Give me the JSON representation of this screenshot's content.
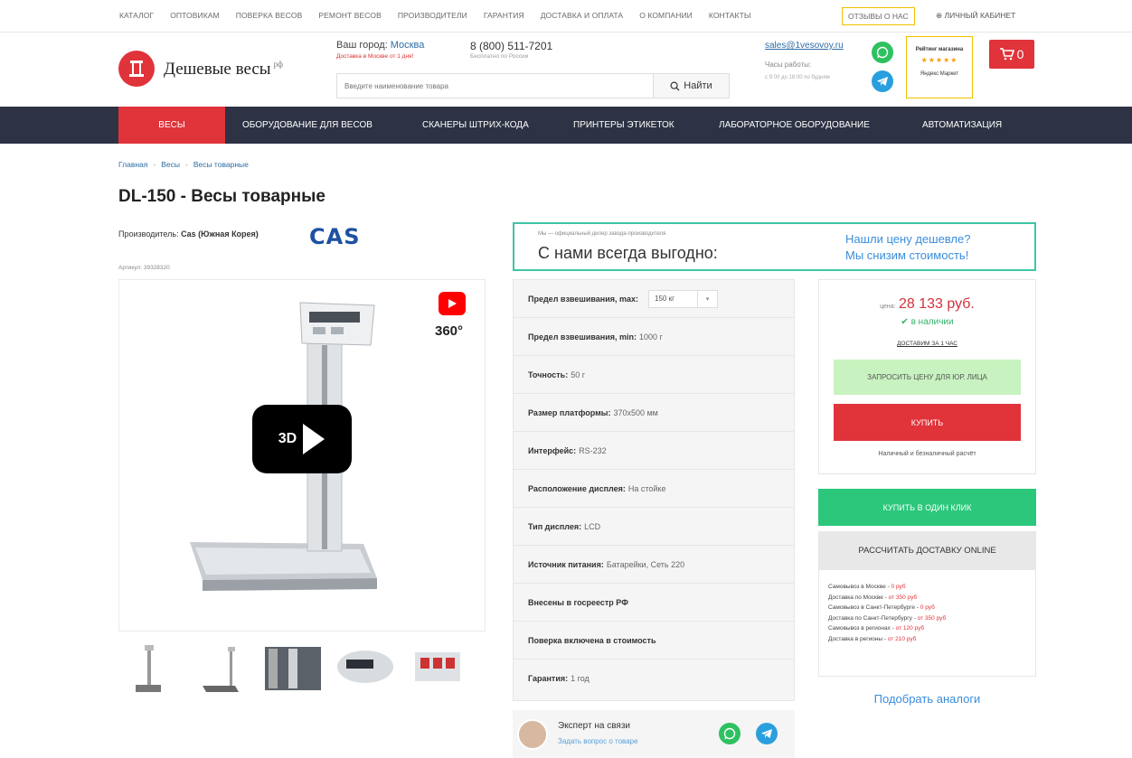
{
  "topbar": {
    "links": [
      "Каталог",
      "Оптовикам",
      "Поверка весов",
      "Ремонт весов",
      "Производители",
      "Гарантия",
      "Доставка и оплата",
      "О компании",
      "Контакты"
    ],
    "reviews": "Отзывы о нас",
    "cabinet": "Личный кабинет"
  },
  "header": {
    "logo_text": "Дешевые весы",
    "logo_suffix": "рф",
    "city_label": "Ваш город:",
    "city": "Москва",
    "city_sub": "Доставка в Москве от 1 дня!",
    "phone": "8 (800) 511-7201",
    "phone_sub": "Бесплатно по России",
    "search_placeholder": "Введите наименование товара",
    "search_button": "Найти",
    "email": "sales@1vesovoy.ru",
    "hours_label": "Часы работы:",
    "hours": "с 9:00 до 18:00 по будням",
    "rating_title": "Рейтинг магазина",
    "rating_stars": "★★★★★",
    "rating_source": "Яндекс Маркет",
    "cart_count": "0"
  },
  "nav": [
    "Весы",
    "Оборудование для весов",
    "Сканеры штрих-кода",
    "Принтеры этикеток",
    "Лабораторное оборудование",
    "Автоматизация"
  ],
  "breadcrumb": [
    "Главная",
    "Весы",
    "Весы товарные"
  ],
  "product": {
    "title": "DL-150 - Весы товарные",
    "maker_label": "Производитель:",
    "maker": "Cas (Южная Корея)",
    "brand_logo": "CAS",
    "sku": "Артикул: 39328320",
    "badge_3d": "3D",
    "badge_360": "360°"
  },
  "promo": {
    "small": "Мы — официальный дилер завода-производителя",
    "big": "С нами всегда выгодно:",
    "link1": "Нашли цену дешевле?",
    "link2": "Мы снизим стоимость!"
  },
  "specs": {
    "limit_max_label": "Предел взвешивания, max:",
    "limit_max_value": "150 кг",
    "rows": [
      {
        "label": "Предел взвешивания, min:",
        "value": "1000 г"
      },
      {
        "label": "Точность:",
        "value": "50 г"
      },
      {
        "label": "Размер платформы:",
        "value": "370x500 мм"
      },
      {
        "label": "Интерфейс:",
        "value": "RS-232"
      },
      {
        "label": "Расположение дисплея:",
        "value": "На стойке"
      },
      {
        "label": "Тип дисплея:",
        "value": "LCD"
      },
      {
        "label": "Источник питания:",
        "value": "Батарейки, Сеть 220"
      },
      {
        "label": "Внесены в госреестр РФ",
        "value": ""
      },
      {
        "label": "Поверка включена в стоимость",
        "value": ""
      },
      {
        "label": "Гарантия:",
        "value": "1 год"
      }
    ]
  },
  "expert": {
    "title": "Эксперт на связи",
    "link": "Задать вопрос о товаре"
  },
  "price": {
    "label": "цена:",
    "value": "28 133 руб.",
    "stock": "в наличии",
    "delivery_1h": "доставим за 1 час",
    "legal_button": "Запросить цену для юр. лица",
    "buy_button": "Купить",
    "pay_note": "Наличный и безналичный расчёт"
  },
  "oneclick_button": "Купить в один клик",
  "calc_button": "Рассчитать доставку ONLINE",
  "delivery_rows": [
    {
      "text": "Самовывоз в Москве - ",
      "price": "0 руб"
    },
    {
      "text": "Доставка по Москве - ",
      "price": "от 350 руб"
    },
    {
      "text": "Самовывоз в Санкт-Петербурге - ",
      "price": "0 руб"
    },
    {
      "text": "Доставка по Санкт-Петербургу - ",
      "price": "от 350 руб"
    },
    {
      "text": "Самовывоз в регионах - ",
      "price": "от 120 руб"
    },
    {
      "text": "Доставка в регионы - ",
      "price": "от 210 руб"
    }
  ],
  "analogs": "Подобрать аналоги",
  "colors": {
    "brand_red": "#e0333a",
    "nav_dark": "#2d3344",
    "accent_green": "#2cc77b",
    "promo_teal": "#3dc6a6",
    "link_blue": "#3a8ddb"
  },
  "icons": [
    "scale-logo-icon",
    "search-icon",
    "whatsapp-icon",
    "telegram-icon",
    "cart-icon",
    "youtube-icon",
    "360-rotate-icon",
    "play-icon",
    "check-icon",
    "chevron-down-icon",
    "user-icon"
  ]
}
